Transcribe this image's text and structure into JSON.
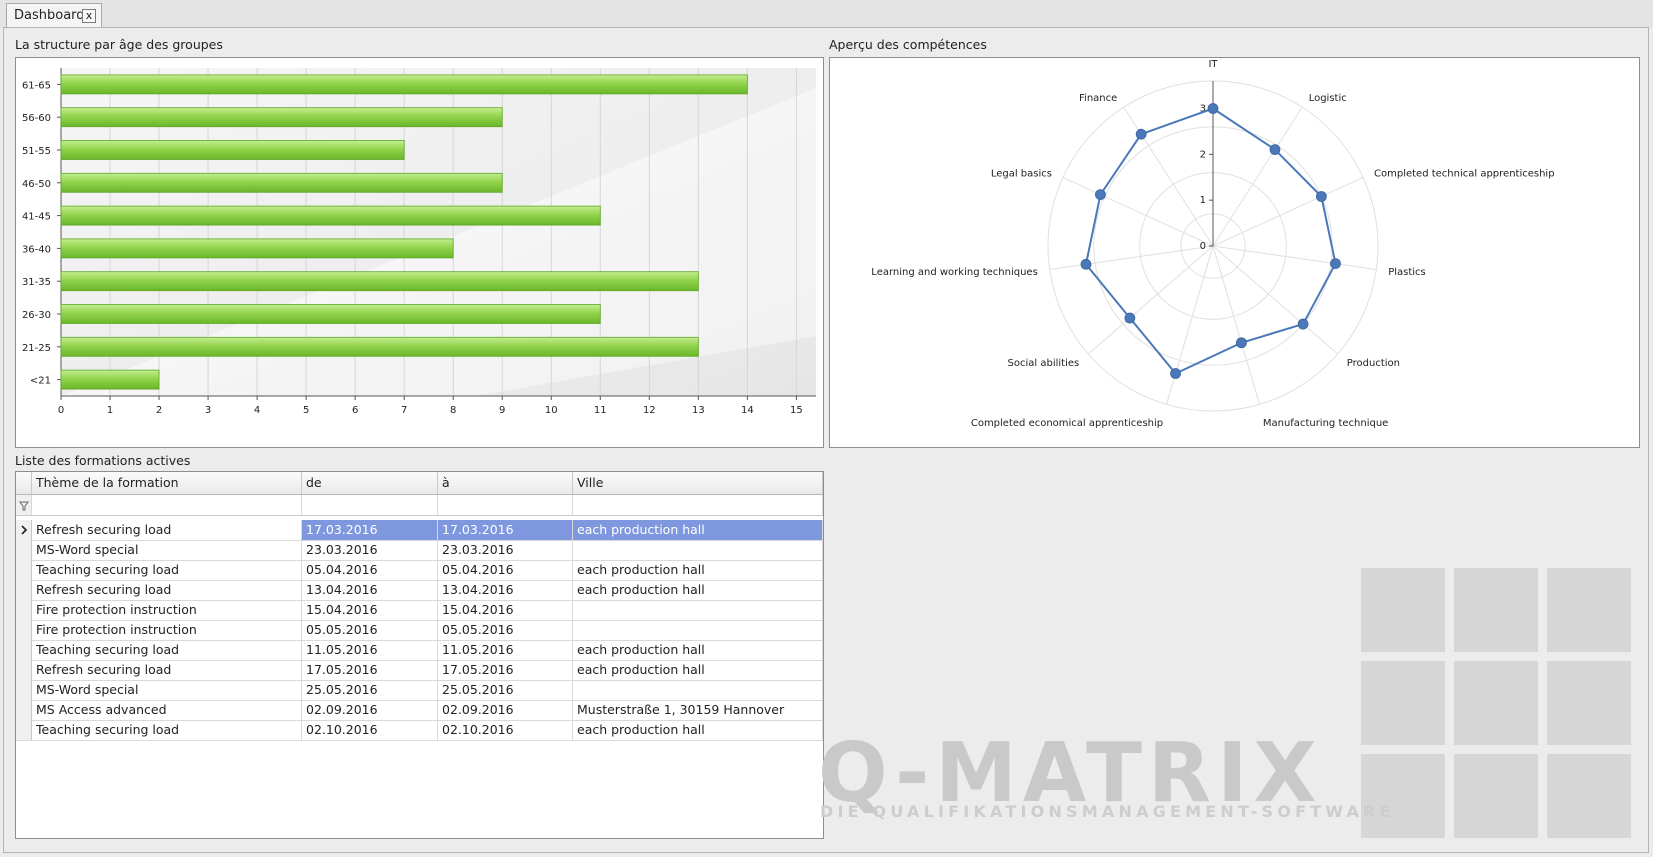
{
  "tab": {
    "label": "Dashboard",
    "close_glyph": "x"
  },
  "age_chart_title": "La structure par âge des groupes",
  "radar_title": "Aperçu des compétences",
  "list_title": "Liste des formations actives",
  "chart_data": [
    {
      "type": "bar",
      "orientation": "horizontal",
      "title": "La structure par âge des groupes",
      "categories": [
        "61-65",
        "56-60",
        "51-55",
        "46-50",
        "41-45",
        "36-40",
        "31-35",
        "26-30",
        "21-25",
        "<21"
      ],
      "values": [
        14,
        9,
        7,
        9,
        11,
        8,
        13,
        11,
        13,
        2
      ],
      "xlim": [
        0,
        15.4
      ],
      "xticks": [
        0,
        1,
        2,
        3,
        4,
        5,
        6,
        7,
        8,
        9,
        10,
        11,
        12,
        13,
        14,
        15
      ],
      "grid": "vertical",
      "bar_color": "#8fd14a"
    },
    {
      "type": "radar",
      "title": "Aperçu des compétences",
      "categories": [
        "IT",
        "Logistic",
        "Completed technical apprenticeship",
        "Plastics",
        "Production",
        "Manufacturing technique",
        "Completed economical apprenticeship",
        "Social abilities",
        "Learning and working techniques",
        "Legal basics",
        "Finance"
      ],
      "values": [
        3,
        2.5,
        2.6,
        2.7,
        2.6,
        2.2,
        2.9,
        2.4,
        2.8,
        2.7,
        2.9
      ],
      "rlim": [
        0,
        3.6
      ],
      "rticks": [
        0,
        1,
        2,
        3
      ],
      "line_color": "#4a78b8"
    }
  ],
  "grid": {
    "columns": [
      "Thème de la formation",
      "de",
      "à",
      "Ville"
    ],
    "filter_icon": "filter-icon",
    "rows": [
      {
        "theme": "Refresh securing load",
        "from": "17.03.2016",
        "to": "17.03.2016",
        "city": "each production hall",
        "selected": true
      },
      {
        "theme": "MS-Word special",
        "from": "23.03.2016",
        "to": "23.03.2016",
        "city": ""
      },
      {
        "theme": "Teaching securing load",
        "from": "05.04.2016",
        "to": "05.04.2016",
        "city": "each production hall"
      },
      {
        "theme": "Refresh securing load",
        "from": "13.04.2016",
        "to": "13.04.2016",
        "city": "each production hall"
      },
      {
        "theme": "Fire protection instruction",
        "from": "15.04.2016",
        "to": "15.04.2016",
        "city": ""
      },
      {
        "theme": "Fire protection instruction",
        "from": "05.05.2016",
        "to": "05.05.2016",
        "city": ""
      },
      {
        "theme": "Teaching securing load",
        "from": "11.05.2016",
        "to": "11.05.2016",
        "city": "each production hall"
      },
      {
        "theme": "Refresh securing load",
        "from": "17.05.2016",
        "to": "17.05.2016",
        "city": "each production hall"
      },
      {
        "theme": "MS-Word special",
        "from": "25.05.2016",
        "to": "25.05.2016",
        "city": ""
      },
      {
        "theme": "MS Access advanced",
        "from": "02.09.2016",
        "to": "02.09.2016",
        "city": "Musterstraße 1, 30159 Hannover"
      },
      {
        "theme": "Teaching securing load",
        "from": "02.10.2016",
        "to": "02.10.2016",
        "city": "each production hall"
      }
    ]
  },
  "branding": {
    "name": "Q-MATRIX",
    "tagline": "DIE QUALIFIKATIONSMANAGEMENT-SOFTWARE"
  }
}
